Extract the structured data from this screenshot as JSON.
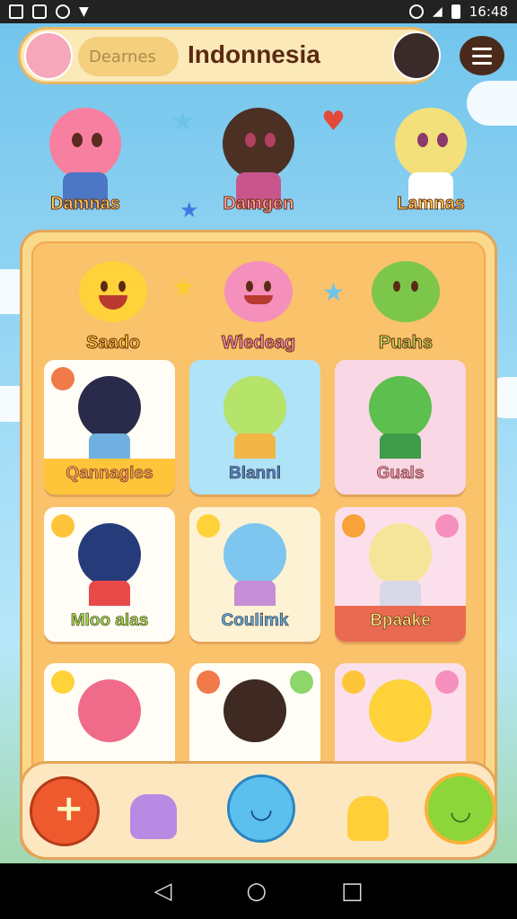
{
  "status": {
    "time": "16:48"
  },
  "header": {
    "search_placeholder": "Dearnes",
    "title": "Indonnesia"
  },
  "heroes": [
    {
      "label": "Damnas"
    },
    {
      "label": "Damgen"
    },
    {
      "label": "Lamnas"
    }
  ],
  "moods": [
    {
      "label": "Saado"
    },
    {
      "label": "Wiedeag"
    },
    {
      "label": "Puahs"
    }
  ],
  "cards": [
    {
      "label": "Qannagies"
    },
    {
      "label": "Blannl"
    },
    {
      "label": "Guals"
    },
    {
      "label": "Mloo alas"
    },
    {
      "label": "Coulimk"
    },
    {
      "label": "Bpaake"
    },
    {
      "label": ""
    },
    {
      "label": ""
    },
    {
      "label": ""
    }
  ],
  "icons": {
    "menu": "menu-icon",
    "add": "plus-icon",
    "nav_pet": "pet-icon",
    "nav_home": "smiley-icon",
    "nav_buddy": "buddy-icon",
    "nav_profile": "profile-icon"
  },
  "colors": {
    "accent": "#f9c26b",
    "brown": "#5b2a12"
  }
}
